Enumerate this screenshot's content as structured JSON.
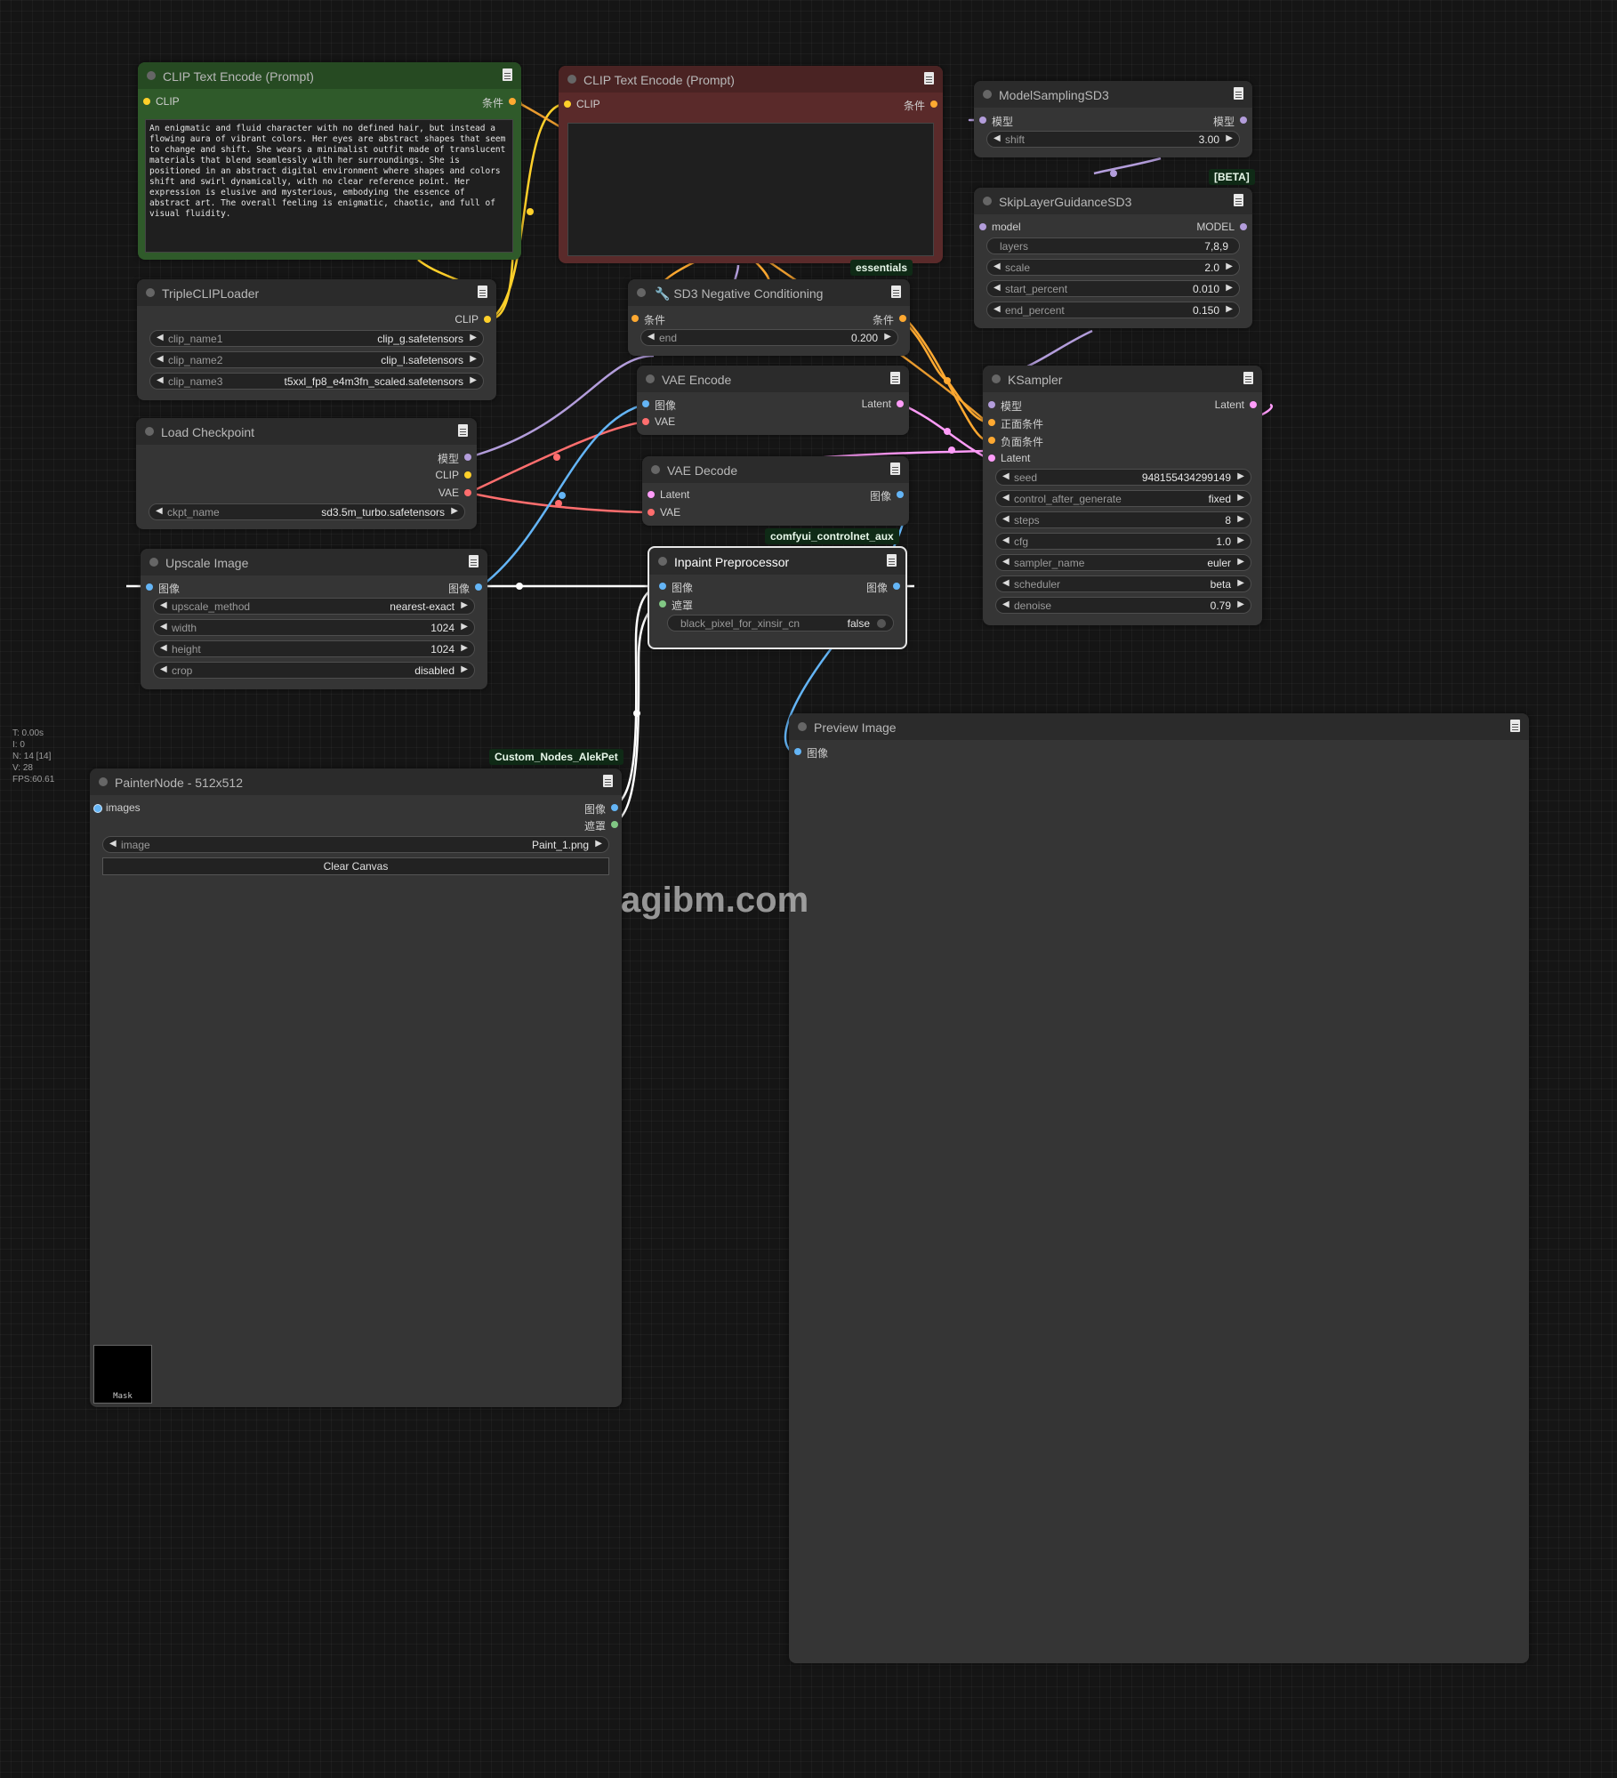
{
  "stats": [
    "T: 0.00s",
    "I: 0",
    "N: 14 [14]",
    "V: 28",
    "FPS:60.61"
  ],
  "watermark": "agibm.com",
  "colors": {
    "canvas_bg": "#151515",
    "node_bg": "#353535",
    "clip_link": "#ffd02a",
    "cond_link": "#ffa931",
    "model_link": "#b39ddb",
    "vae_link": "#ff6e6e",
    "image_link": "#64b5f6",
    "latent_link": "#ff9cf9",
    "mask_link": "#81c784",
    "positive_node": "#2f5a2a",
    "negative_node": "#5a2a2a"
  },
  "nodes": {
    "clip_pos": {
      "title": "CLIP Text Encode (Prompt)",
      "in_clip": "CLIP",
      "out_cond": "条件",
      "text": "An enigmatic and fluid character with no defined hair, but instead a flowing aura of vibrant colors. Her eyes are abstract shapes that seem to change and shift. She wears a minimalist outfit made of translucent materials that blend seamlessly with her surroundings. She is positioned in an abstract digital environment where shapes and colors shift and swirl dynamically, with no clear reference point. Her expression is elusive and mysterious, embodying the essence of abstract art. The overall feeling is enigmatic, chaotic, and full of visual fluidity."
    },
    "clip_neg": {
      "title": "CLIP Text Encode (Prompt)",
      "in_clip": "CLIP",
      "out_cond": "条件",
      "text": ""
    },
    "triple_clip": {
      "title": "TripleCLIPLoader",
      "out_clip": "CLIP",
      "w1_name": "clip_name1",
      "w1_val": "clip_g.safetensors",
      "w2_name": "clip_name2",
      "w2_val": "clip_l.safetensors",
      "w3_name": "clip_name3",
      "w3_val": "t5xxl_fp8_e4m3fn_scaled.safetensors"
    },
    "load_ckpt": {
      "title": "Load Checkpoint",
      "out_model": "模型",
      "out_clip": "CLIP",
      "out_vae": "VAE",
      "w_name": "ckpt_name",
      "w_val": "sd3.5m_turbo.safetensors"
    },
    "upscale": {
      "title": "Upscale Image",
      "in_image": "图像",
      "out_image": "图像",
      "w1_name": "upscale_method",
      "w1_val": "nearest-exact",
      "w2_name": "width",
      "w2_val": "1024",
      "w3_name": "height",
      "w3_val": "1024",
      "w4_name": "crop",
      "w4_val": "disabled"
    },
    "painter": {
      "title": "PainterNode - 512x512",
      "badge": "Custom_Nodes_AlekPet",
      "in_images": "images",
      "out_image": "图像",
      "out_mask": "遮罩",
      "w_name": "image",
      "w_val": "Paint_1.png",
      "clear": "Clear Canvas",
      "mask_label": "Mask"
    },
    "sd3_neg": {
      "title": "SD3 Negative Conditioning",
      "badge": "essentials",
      "in_cond": "条件",
      "out_cond": "条件",
      "w_name": "end",
      "w_val": "0.200"
    },
    "vae_encode": {
      "title": "VAE Encode",
      "in_image": "图像",
      "in_vae": "VAE",
      "out_latent": "Latent"
    },
    "vae_decode": {
      "title": "VAE Decode",
      "in_latent": "Latent",
      "in_vae": "VAE",
      "out_image": "图像"
    },
    "inpaint": {
      "title": "Inpaint Preprocessor",
      "badge": "comfyui_controlnet_aux",
      "in_image": "图像",
      "in_mask": "遮罩",
      "out_image": "图像",
      "w_name": "black_pixel_for_xinsir_cn",
      "w_val": "false"
    },
    "model_sampling": {
      "title": "ModelSamplingSD3",
      "in_model": "模型",
      "out_model": "模型",
      "w_name": "shift",
      "w_val": "3.00"
    },
    "skip_layer": {
      "title": "SkipLayerGuidanceSD3",
      "badge": "[BETA]",
      "in_model": "model",
      "out_model": "MODEL",
      "w1_name": "layers",
      "w1_val": "7,8,9",
      "w2_name": "scale",
      "w2_val": "2.0",
      "w3_name": "start_percent",
      "w3_val": "0.010",
      "w4_name": "end_percent",
      "w4_val": "0.150"
    },
    "ksampler": {
      "title": "KSampler",
      "in_model": "模型",
      "in_pos": "正面条件",
      "in_neg": "负面条件",
      "in_latent": "Latent",
      "out_latent": "Latent",
      "w1_name": "seed",
      "w1_val": "948155434299149",
      "w2_name": "control_after_generate",
      "w2_val": "fixed",
      "w3_name": "steps",
      "w3_val": "8",
      "w4_name": "cfg",
      "w4_val": "1.0",
      "w5_name": "sampler_name",
      "w5_val": "euler",
      "w6_name": "scheduler",
      "w6_val": "beta",
      "w7_name": "denoise",
      "w7_val": "0.79"
    },
    "preview": {
      "title": "Preview Image",
      "in_image": "图像"
    }
  }
}
